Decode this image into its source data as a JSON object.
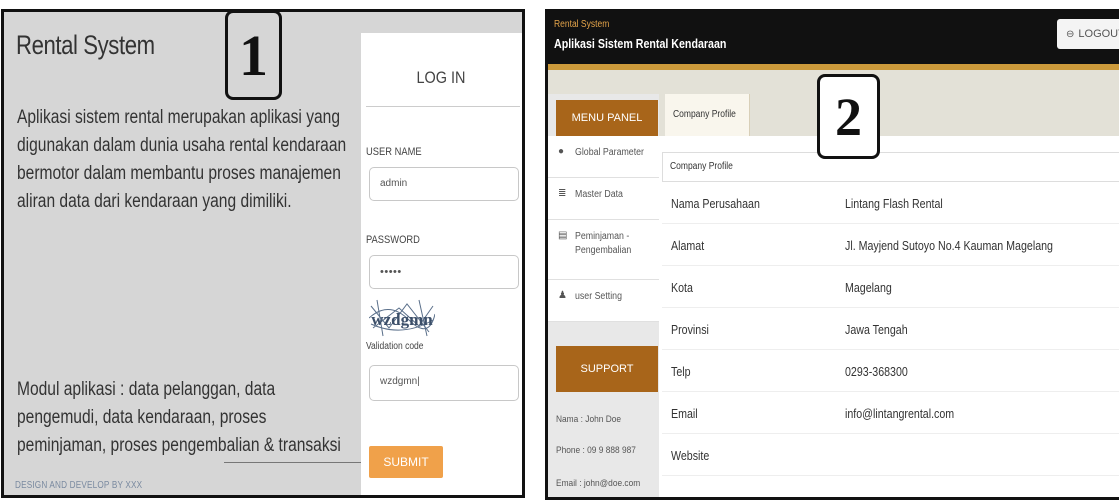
{
  "panel1": {
    "title": "Rental System",
    "description": "Aplikasi sistem rental merupakan aplikasi yang digunakan dalam dunia usaha rental kendaraan bermotor dalam membantu proses manajemen aliran data dari kendaraan yang dimiliki.",
    "modules": "Modul aplikasi : data pelanggan, data pengemudi, data kendaraan, proses peminjaman, proses pengembalian & transaksi",
    "footer": "DESIGN AND DEVELOP BY XXX",
    "login": {
      "heading": "LOG IN",
      "username_label": "USER NAME",
      "username_value": "admin",
      "password_label": "PASSWORD",
      "password_value": "•••••",
      "validation_label": "Validation code",
      "validation_value": "wzdgmn|",
      "captcha_text": "wzdgmn",
      "submit_label": "SUBMIT"
    },
    "marker": "1"
  },
  "panel2": {
    "marker": "2",
    "header": {
      "subtitle": "Rental System",
      "title": "Aplikasi Sistem Rental Kendaraan",
      "logout_label": "LOGOUT",
      "logout_icon": "logout-icon"
    },
    "sidebar": {
      "menu_title": "MENU PANEL",
      "items": [
        {
          "icon": "map-marker-icon",
          "glyph": "⬤",
          "label": "Global Parameter"
        },
        {
          "icon": "database-icon",
          "glyph": "≣",
          "label": "Master Data"
        },
        {
          "icon": "document-icon",
          "glyph": "🗎",
          "label": "Peminjaman -",
          "label2": "Pengembalian"
        },
        {
          "icon": "user-icon",
          "glyph": "♟",
          "label": "user Setting"
        }
      ],
      "support_title": "SUPPORT",
      "support_name": "Nama : John Doe",
      "support_phone": "Phone : 09 9 888 987",
      "support_email": "Email : john@doe.com"
    },
    "main": {
      "tab_label": "Company Profile",
      "card_title": "Company Profile",
      "rows": [
        {
          "key": "Nama Perusahaan",
          "value": "Lintang Flash Rental"
        },
        {
          "key": "Alamat",
          "value": "Jl. Mayjend Sutoyo No.4 Kauman Magelang"
        },
        {
          "key": "Kota",
          "value": "Magelang"
        },
        {
          "key": "Provinsi",
          "value": "Jawa Tengah"
        },
        {
          "key": "Telp",
          "value": "0293-368300"
        },
        {
          "key": "Email",
          "value": "info@lintangrental.com"
        },
        {
          "key": "Website",
          "value": ""
        }
      ]
    }
  },
  "colors": {
    "accent_orange": "#f0a14a",
    "menu_brown": "#a8651a",
    "stripe_gold": "#cc9a3b",
    "topbar_dark": "#111111"
  }
}
